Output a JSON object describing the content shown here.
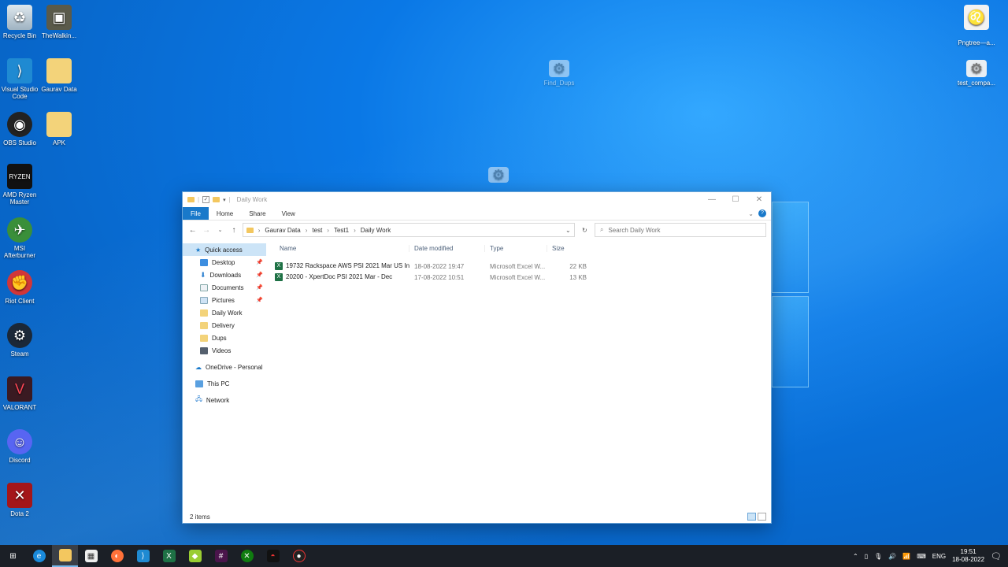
{
  "desktop": {
    "icons": [
      {
        "label": "Recycle Bin",
        "icon": "recycle-bin-icon"
      },
      {
        "label": "TheWalkin...",
        "icon": "shortcut-image-icon"
      },
      {
        "label": "Visual Studio Code",
        "icon": "vscode-icon"
      },
      {
        "label": "Gaurav Data",
        "icon": "folder-icon"
      },
      {
        "label": "OBS Studio",
        "icon": "obs-icon"
      },
      {
        "label": "APK",
        "icon": "folder-icon"
      },
      {
        "label": "AMD Ryzen Master",
        "icon": "ryzen-icon"
      },
      {
        "label": "MSI Afterburner",
        "icon": "msi-afterburner-icon"
      },
      {
        "label": "Riot Client",
        "icon": "riot-icon"
      },
      {
        "label": "Steam",
        "icon": "steam-icon"
      },
      {
        "label": "VALORANT",
        "icon": "valorant-icon"
      },
      {
        "label": "Discord",
        "icon": "discord-icon"
      },
      {
        "label": "Dota 2",
        "icon": "dota2-icon"
      },
      {
        "label": "Find_Dups",
        "icon": "script-icon"
      },
      {
        "label": "Pngtree—a...",
        "icon": "lion-image-icon"
      },
      {
        "label": "test_compa...",
        "icon": "script-icon"
      }
    ]
  },
  "explorer": {
    "title": "Daily Work",
    "ribbon_tabs": [
      "File",
      "Home",
      "Share",
      "View"
    ],
    "breadcrumb": [
      "Gaurav Data",
      "test",
      "Test1",
      "Daily Work"
    ],
    "search_placeholder": "Search Daily Work",
    "nav": {
      "quick_access": "Quick access",
      "items": [
        {
          "label": "Desktop",
          "pinned": true
        },
        {
          "label": "Downloads",
          "pinned": true
        },
        {
          "label": "Documents",
          "pinned": true
        },
        {
          "label": "Pictures",
          "pinned": true
        },
        {
          "label": "Daily Work",
          "pinned": false
        },
        {
          "label": "Delivery",
          "pinned": false
        },
        {
          "label": "Dups",
          "pinned": false
        },
        {
          "label": "Videos",
          "pinned": false
        }
      ],
      "onedrive": "OneDrive - Personal",
      "this_pc": "This PC",
      "network": "Network"
    },
    "columns": {
      "name": "Name",
      "date": "Date modified",
      "type": "Type",
      "size": "Size"
    },
    "files": [
      {
        "name": "19732 Rackspace AWS PSI 2021 Mar US Inc",
        "date": "18-08-2022 19:47",
        "type": "Microsoft Excel W...",
        "size": "22 KB"
      },
      {
        "name": "20200 - XpertDoc PSI 2021 Mar - Dec",
        "date": "17-08-2022 10:51",
        "type": "Microsoft Excel W...",
        "size": "13 KB"
      }
    ],
    "status": "2 items"
  },
  "taskbar": {
    "apps": [
      "start-icon",
      "edge-icon",
      "file-explorer-icon",
      "store-icon",
      "firefox-icon",
      "vscode-icon",
      "excel-icon",
      "app-icon",
      "slack-icon",
      "xbox-icon",
      "ryzen-icon",
      "app-icon"
    ],
    "language": "ENG",
    "time": "19:51",
    "date": "18-08-2022"
  },
  "colors": {
    "accent": "#1979ca",
    "selection": "#cce4f7",
    "excel": "#1e7145"
  }
}
